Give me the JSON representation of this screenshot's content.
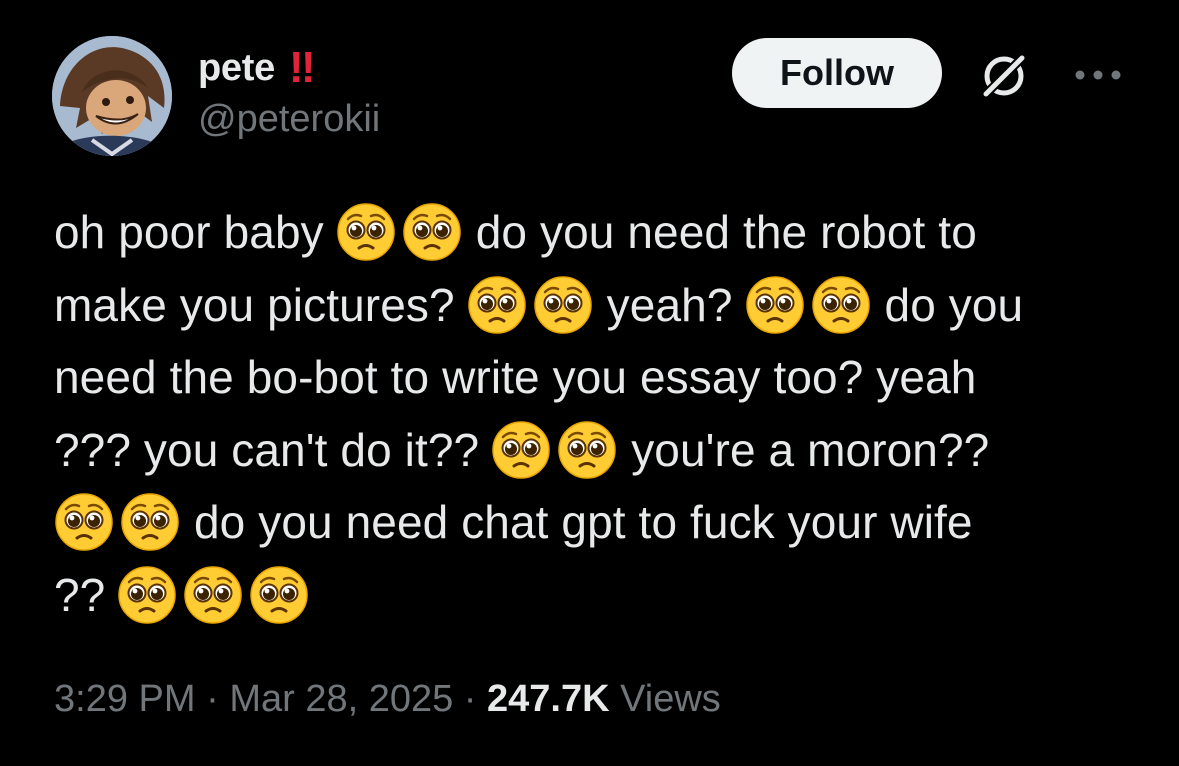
{
  "author": {
    "display_name": "pete",
    "name_badge": "‼",
    "handle": "@peterokii"
  },
  "actions": {
    "follow_label": "Follow",
    "icons": [
      "grok-icon",
      "more-icon"
    ]
  },
  "tweet": {
    "lines": [
      [
        {
          "t": "text",
          "v": "oh poor baby"
        },
        {
          "t": "emoji",
          "n": 2
        },
        {
          "t": "text",
          "v": "do you need the robot to"
        }
      ],
      [
        {
          "t": "text",
          "v": "make you pictures?"
        },
        {
          "t": "emoji",
          "n": 2
        },
        {
          "t": "text",
          "v": "yeah?"
        },
        {
          "t": "emoji",
          "n": 2
        },
        {
          "t": "text",
          "v": "do you"
        }
      ],
      [
        {
          "t": "text",
          "v": "need the bo-bot to write you essay too? yeah"
        }
      ],
      [
        {
          "t": "text",
          "v": "??? you can't do it??"
        },
        {
          "t": "emoji",
          "n": 2
        },
        {
          "t": "text",
          "v": "you're a moron??"
        }
      ],
      [
        {
          "t": "emoji",
          "n": 2
        },
        {
          "t": "text",
          "v": "do you need chat gpt to fuck your wife"
        }
      ],
      [
        {
          "t": "text",
          "v": "??"
        },
        {
          "t": "emoji",
          "n": 3
        }
      ]
    ],
    "emoji_name": "pleading-face-emoji"
  },
  "meta": {
    "time": "3:29 PM",
    "separator": "·",
    "date": "Mar 28, 2025",
    "views_count": "247.7K",
    "views_label": "Views"
  },
  "colors": {
    "background": "#000000",
    "text": "#e7e9ea",
    "muted": "#71767b",
    "badge": "#e0243a",
    "follow_bg": "#eff3f4",
    "emoji": "#ffcc33"
  }
}
